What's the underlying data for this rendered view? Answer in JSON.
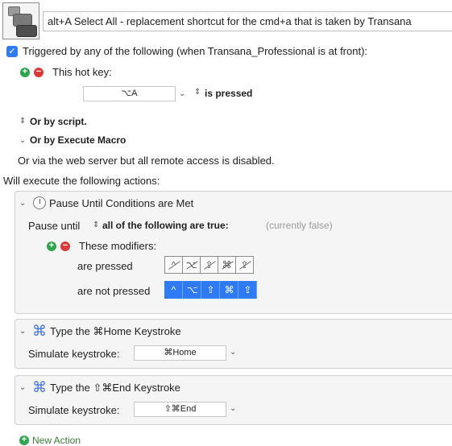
{
  "macro": {
    "name": "alt+A Select All - replacement shortcut for the  cmd+a that is taken by Transana"
  },
  "trigger": {
    "checkbox_label": "Triggered by any of the following (when Transana_Professional is at front):",
    "hotkey_label": "This hot key:",
    "hotkey_value": "⌥A",
    "hotkey_condition": "is pressed",
    "by_script": "Or by script.",
    "by_execute_macro": "Or by Execute Macro",
    "web_server": "Or via the web server but all remote access is disabled."
  },
  "actions_heading": "Will execute the following actions:",
  "pause_action": {
    "title": "Pause Until Conditions are Met",
    "pause_until_label": "Pause until",
    "condition": "all of the following are true:",
    "status": "(currently false)",
    "modifiers_label": "These modifiers:",
    "pressed_label": "are pressed",
    "not_pressed_label": "are not pressed",
    "modifier_keys": [
      "^",
      "⌥",
      "⇧",
      "⌘",
      "⇪"
    ]
  },
  "type_action_1": {
    "title": "Type the ⌘Home Keystroke",
    "simulate_label": "Simulate keystroke:",
    "keystroke": "⌘Home"
  },
  "type_action_2": {
    "title": "Type the ⇧⌘End Keystroke",
    "simulate_label": "Simulate keystroke:",
    "keystroke": "⇧⌘End"
  },
  "new_action": "New Action",
  "colors": {
    "accent_blue": "#2f7bf5",
    "add_green": "#2ea44f",
    "remove_red": "#d93a3a"
  }
}
